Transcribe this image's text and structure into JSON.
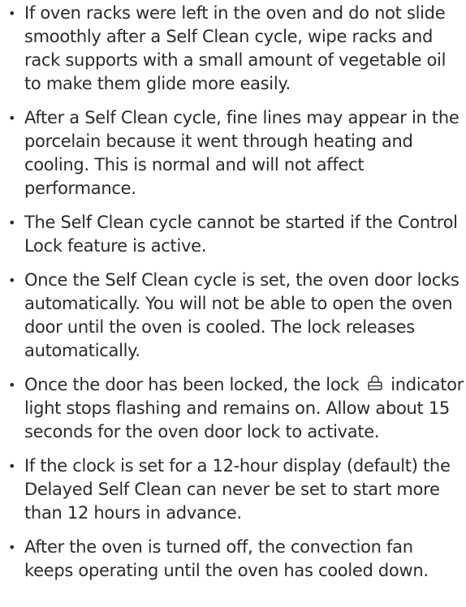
{
  "bullets": [
    "If oven racks were left in the oven and do not slide smoothly after a Self Clean cycle, wipe racks and rack supports with a small amount of vegetable oil to make them glide more easily.",
    "After a Self Clean cycle, fine lines may appear in the porcelain because it went through heating and cooling. This is normal and will not affect performance.",
    "The Self Clean cycle cannot be started if the Control Lock feature is active.",
    "Once the Self Clean cycle is set, the oven door locks automatically. You will not be able to open the oven door until the oven is cooled. The lock releases automatically.",
    {
      "before_icon": "Once the door has been locked, the lock",
      "icon": "lock-icon",
      "after_icon": "indicator light stops flashing and remains on. Allow about 15 seconds for the oven door lock to activate."
    },
    "If the clock is set for a 12-hour display (default) the Delayed Self Clean can never be set to start more than 12 hours in advance.",
    "After the oven is turned off, the convection fan keeps operating until the oven has cooled down."
  ]
}
